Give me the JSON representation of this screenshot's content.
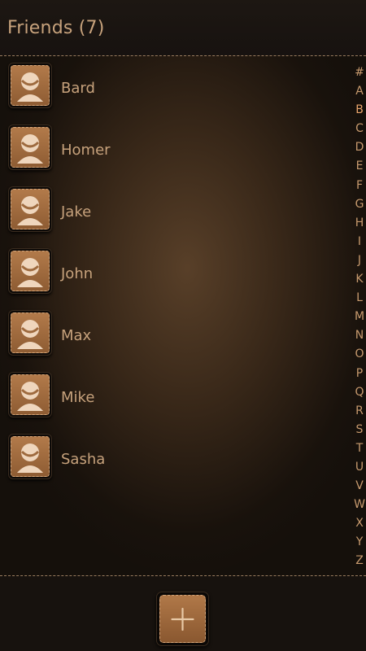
{
  "header": {
    "title": "Friends (7)"
  },
  "contacts": [
    {
      "name": "Bard"
    },
    {
      "name": "Homer"
    },
    {
      "name": "Jake"
    },
    {
      "name": "John"
    },
    {
      "name": "Max"
    },
    {
      "name": "Mike"
    },
    {
      "name": "Sasha"
    }
  ],
  "index": {
    "letters": [
      "#",
      "A",
      "B",
      "C",
      "D",
      "E",
      "F",
      "G",
      "H",
      "I",
      "J",
      "K",
      "L",
      "M",
      "N",
      "O",
      "P",
      "Q",
      "R",
      "S",
      "T",
      "U",
      "V",
      "W",
      "X",
      "Y",
      "Z"
    ],
    "active": "B"
  },
  "icons": {
    "avatar": "person-icon",
    "add": "plus-icon"
  },
  "colors": {
    "text": "#c7a27c",
    "accent": "#e9a56c",
    "leather": "#a36d40"
  }
}
